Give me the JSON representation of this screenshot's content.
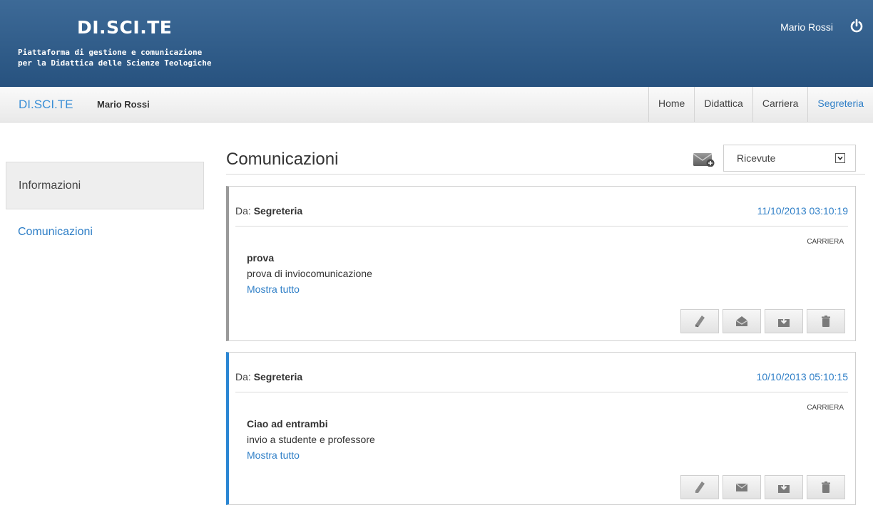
{
  "header": {
    "title": "DI.SCI.TE",
    "subtitle_line1": "Piattaforma di gestione e comunicazione",
    "subtitle_line2": "per la Didattica delle Scienze Teologiche",
    "user": "Mario Rossi",
    "power_icon": "power-icon"
  },
  "navbar": {
    "brand": "DI.SCI.TE",
    "user": "Mario Rossi",
    "tabs": [
      {
        "label": "Home"
      },
      {
        "label": "Didattica"
      },
      {
        "label": "Carriera"
      },
      {
        "label": "Segreteria",
        "active": true
      }
    ]
  },
  "sidebar": {
    "items": [
      {
        "label": "Informazioni"
      },
      {
        "label": "Comunicazioni"
      }
    ]
  },
  "main": {
    "title": "Comunicazioni",
    "compose_icon": "envelope-plus-icon",
    "filter": {
      "selected": "Ricevute"
    }
  },
  "messages": [
    {
      "from_label": "Da:",
      "from": "Segreteria",
      "date": "11/10/2013 03:10:19",
      "tag": "CARRIERA",
      "subject": "prova",
      "body": "prova di inviocomunicazione",
      "more": "Mostra tutto",
      "status": "read"
    },
    {
      "from_label": "Da:",
      "from": "Segreteria",
      "date": "10/10/2013 05:10:15",
      "tag": "CARRIERA",
      "subject": "Ciao ad entrambi",
      "body": "invio a studente e professore",
      "more": "Mostra tutto",
      "status": "unread"
    }
  ],
  "colors": {
    "header_bg": "#2f5b88",
    "link_blue": "#2f7fc7",
    "unread_accent": "#2a86d3",
    "read_accent": "#9a9a9a"
  }
}
